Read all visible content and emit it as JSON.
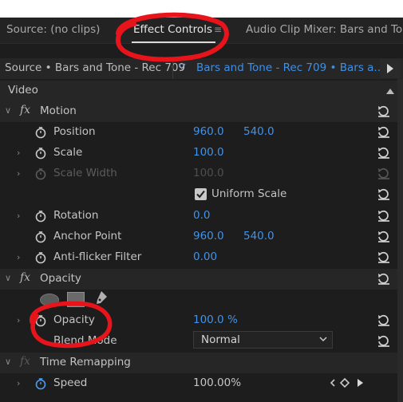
{
  "tabs": [
    {
      "label": "Source: (no clips)"
    },
    {
      "label": "Effect Controls"
    },
    {
      "label": "Audio Clip Mixer: Bars and Tone"
    }
  ],
  "source_bar": {
    "master": "Source • Bars and Tone - Rec 709",
    "clip": "Bars and Tone - Rec 709 • Bars a..."
  },
  "sections": {
    "video": "Video",
    "motion": "Motion",
    "opacity_section": "Opacity",
    "time_remapping": "Time Remapping"
  },
  "properties": {
    "position": {
      "label": "Position",
      "x": "960.0",
      "y": "540.0"
    },
    "scale": {
      "label": "Scale",
      "value": "100.0"
    },
    "scale_width": {
      "label": "Scale Width",
      "value": "100.0"
    },
    "uniform_scale": {
      "label": "Uniform Scale",
      "checked": true
    },
    "rotation": {
      "label": "Rotation",
      "value": "0.0"
    },
    "anchor_point": {
      "label": "Anchor Point",
      "x": "960.0",
      "y": "540.0"
    },
    "anti_flicker": {
      "label": "Anti-flicker Filter",
      "value": "0.00"
    },
    "opacity": {
      "label": "Opacity",
      "value": "100.0 %"
    },
    "blend_mode": {
      "label": "Blend Mode",
      "value": "Normal"
    },
    "speed": {
      "label": "Speed",
      "value": "100.00%"
    }
  },
  "colors": {
    "accent_blue": "#3f93ea",
    "annotation_red": "#e8141c"
  },
  "icons": [
    "menu-icon",
    "play-icon",
    "stopwatch-icon",
    "reset-icon",
    "fx-icon",
    "ellipse-mask-icon",
    "rectangle-mask-icon",
    "pen-mask-icon",
    "chevron-icon",
    "checkmark-icon",
    "keyframe-nav-icon"
  ]
}
